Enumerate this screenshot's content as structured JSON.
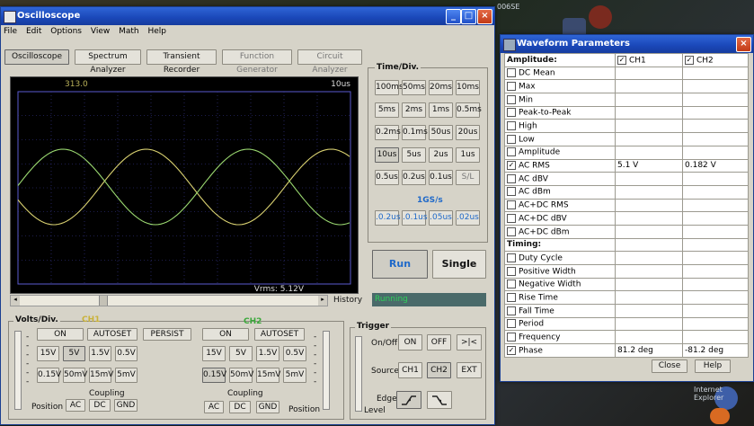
{
  "scope": {
    "title": "Oscilloscope",
    "menu": [
      "File",
      "Edit",
      "Options",
      "View",
      "Math",
      "Help"
    ],
    "tabs": [
      {
        "label": "Oscilloscope",
        "state": "active"
      },
      {
        "label": "Spectrum Analyzer",
        "state": "enabled"
      },
      {
        "label": "Transient Recorder",
        "state": "enabled"
      },
      {
        "label": "Function Generator",
        "state": "disabled"
      },
      {
        "label": "Circuit Analyzer",
        "state": "disabled"
      }
    ],
    "display": {
      "top_left": "313.0",
      "top_right": "10us",
      "bottom_readout": "Vrms: 5.12V"
    },
    "history_label": "History",
    "time_div": {
      "title": "Time/Div.",
      "buttons": [
        "100ms",
        "50ms",
        "20ms",
        "10ms",
        "5ms",
        "2ms",
        "1ms",
        "0.5ms",
        "0.2ms",
        "0.1ms",
        "50us",
        "20us",
        "10us",
        "5us",
        "2us",
        "1us",
        "0.5us",
        "0.2us",
        "0.1us",
        "S/L"
      ],
      "rate_label": "1GS/s",
      "rate_buttons": [
        ".0.2us",
        ".0.1us",
        ".05us",
        ".02us"
      ]
    },
    "run_label": "Run",
    "single_label": "Single",
    "status": "Running",
    "volts": {
      "title": "Volts/Div.",
      "ch1_label": "CH1",
      "ch2_label": "CH2",
      "on": "ON",
      "autoset": "AUTOSET",
      "persist": "PERSIST",
      "ch1_buttons": [
        "15V",
        "5V",
        "1.5V",
        "0.5V",
        "0.15V",
        "50mV",
        "15mV",
        "5mV"
      ],
      "ch2_buttons": [
        "15V",
        "5V",
        "1.5V",
        "0.5V",
        "0.15V",
        "50mV",
        "15mV",
        "5mV"
      ],
      "coupling": "Coupling",
      "position": "Position",
      "ac": "AC",
      "dc": "DC",
      "gnd": "GND"
    },
    "trigger": {
      "title": "Trigger",
      "onoff": "On/Off",
      "on": "ON",
      "off": "OFF",
      "auto": ">|<",
      "source": "Source",
      "ch1": "CH1",
      "ch2": "CH2",
      "ext": "EXT",
      "edge": "Edge",
      "level": "Level"
    }
  },
  "params": {
    "title": "Waveform Parameters",
    "ch1": "CH1",
    "ch2": "CH2",
    "amplitude_header": "Amplitude:",
    "timing_header": "Timing:",
    "amplitude_rows": [
      {
        "label": "DC  Mean",
        "checked": false,
        "ch1": "",
        "ch2": ""
      },
      {
        "label": "Max",
        "checked": false,
        "ch1": "",
        "ch2": ""
      },
      {
        "label": "Min",
        "checked": false,
        "ch1": "",
        "ch2": ""
      },
      {
        "label": "Peak-to-Peak",
        "checked": false,
        "ch1": "",
        "ch2": ""
      },
      {
        "label": "High",
        "checked": false,
        "ch1": "",
        "ch2": ""
      },
      {
        "label": "Low",
        "checked": false,
        "ch1": "",
        "ch2": ""
      },
      {
        "label": "Amplitude",
        "checked": false,
        "ch1": "",
        "ch2": ""
      },
      {
        "label": "AC RMS",
        "checked": true,
        "ch1": "5.1 V",
        "ch2": "0.182 V"
      },
      {
        "label": "AC dBV",
        "checked": false,
        "ch1": "",
        "ch2": ""
      },
      {
        "label": "AC dBm",
        "checked": false,
        "ch1": "",
        "ch2": ""
      },
      {
        "label": "AC+DC RMS",
        "checked": false,
        "ch1": "",
        "ch2": ""
      },
      {
        "label": "AC+DC dBV",
        "checked": false,
        "ch1": "",
        "ch2": ""
      },
      {
        "label": "AC+DC dBm",
        "checked": false,
        "ch1": "",
        "ch2": ""
      }
    ],
    "timing_rows": [
      {
        "label": "Duty Cycle",
        "checked": false,
        "ch1": "",
        "ch2": ""
      },
      {
        "label": "Positive Width",
        "checked": false,
        "ch1": "",
        "ch2": ""
      },
      {
        "label": "Negative Width",
        "checked": false,
        "ch1": "",
        "ch2": ""
      },
      {
        "label": "Rise Time",
        "checked": false,
        "ch1": "",
        "ch2": ""
      },
      {
        "label": "Fall Time",
        "checked": false,
        "ch1": "",
        "ch2": ""
      },
      {
        "label": "Period",
        "checked": false,
        "ch1": "",
        "ch2": ""
      },
      {
        "label": "Frequency",
        "checked": false,
        "ch1": "",
        "ch2": ""
      },
      {
        "label": "Phase",
        "checked": true,
        "ch1": "81.2 deg",
        "ch2": "-81.2 deg"
      }
    ],
    "close": "Close",
    "help": "Help"
  },
  "desktop": {
    "top_label": "006SE",
    "bottom_label": "Internet Explorer"
  }
}
